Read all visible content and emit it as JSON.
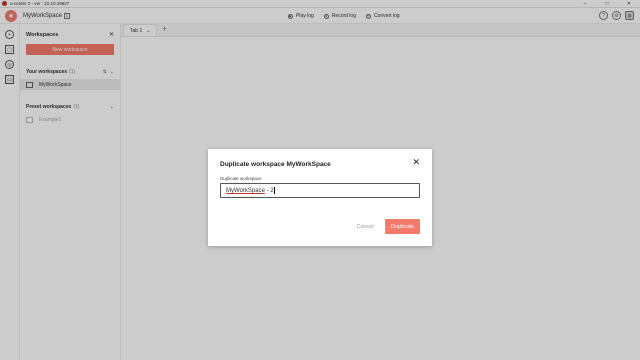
{
  "window": {
    "title": "u-center 2 - ver : 22.10.29627",
    "controls": [
      "–",
      "□",
      "✕"
    ]
  },
  "header": {
    "logo_glyph": "◉",
    "workspace_name": "MyWorkSpace",
    "workspace_badge": "1",
    "actions": [
      {
        "label": "Play log",
        "icon": "play-icon",
        "glyph": "▶"
      },
      {
        "label": "Record log",
        "icon": "record-icon",
        "glyph": "●"
      },
      {
        "label": "Convert log",
        "icon": "convert-icon",
        "glyph": "↻"
      }
    ],
    "right_icons": [
      {
        "icon": "help-icon",
        "glyph": "?"
      },
      {
        "icon": "settings-icon",
        "glyph": "⚙"
      },
      {
        "icon": "user-avatar-icon",
        "glyph": "◍"
      }
    ]
  },
  "rail": {
    "items": [
      {
        "icon": "add-icon",
        "glyph": "+"
      },
      {
        "icon": "device-icon",
        "glyph": "▢"
      },
      {
        "icon": "dashboard-icon",
        "glyph": "◎"
      },
      {
        "icon": "workspace-icon",
        "glyph": "▭"
      }
    ]
  },
  "panel": {
    "title": "Workspaces",
    "close_glyph": "✕",
    "new_button": "New workspace",
    "your_section": {
      "title": "Your workspaces",
      "count": "(1)",
      "tools": [
        "⇅",
        "⌄"
      ]
    },
    "your_items": [
      {
        "name": "MyWorkSpace"
      }
    ],
    "preset_section": {
      "title": "Preset workspaces",
      "count": "(1)",
      "tools": [
        "⌄"
      ]
    },
    "preset_items": [
      {
        "name": "Example1"
      }
    ]
  },
  "tabs": {
    "items": [
      {
        "label": "Tab 1",
        "close_glyph": "⌄"
      }
    ],
    "add_glyph": "+"
  },
  "dialog": {
    "title": "Duplicate workspace MyWorkSpace",
    "close_glyph": "✕",
    "field_label": "Duplicate workspace",
    "field_value": "MyWorkSpace - 2",
    "field_value_underlined": "MyWorkSpace",
    "field_value_rest": " - 2",
    "cancel_label": "Cancel",
    "confirm_label": "Duplicate"
  },
  "colors": {
    "accent": "#f57a6c",
    "overlay": "rgba(0,0,0,0.2)"
  }
}
